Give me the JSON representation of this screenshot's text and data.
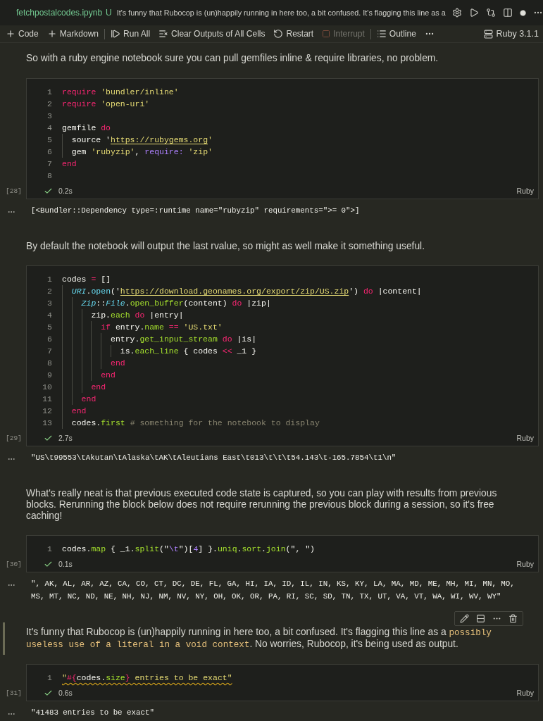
{
  "tab": {
    "file_name": "fetchpostalcodes.ipynb",
    "git_status": "U",
    "breadcrumb": "It's funny that Rubocop is (un)happily running in here too, a bit confused. It's flagging this line as a"
  },
  "toolbar": {
    "groups": [
      {
        "items": [
          {
            "kind": "add",
            "label": "Code",
            "disabled": false
          },
          {
            "kind": "add",
            "label": "Markdown",
            "disabled": false
          }
        ]
      },
      {
        "items": [
          {
            "kind": "run_all",
            "label": "Run All",
            "disabled": false
          },
          {
            "kind": "clear",
            "label": "Clear Outputs of All Cells",
            "disabled": false
          },
          {
            "kind": "restart",
            "label": "Restart",
            "disabled": false
          },
          {
            "kind": "interrupt",
            "label": "Interrupt",
            "disabled": true
          }
        ]
      },
      {
        "items": [
          {
            "kind": "outline",
            "label": "Outline",
            "disabled": false
          },
          {
            "kind": "more",
            "disabled": false
          }
        ]
      }
    ],
    "kernel": "Ruby 3.1.1"
  },
  "cells": [
    {
      "kind": "markdown",
      "selected": false,
      "parts": [
        {
          "kind": "text",
          "text": "So with a ruby engine notebook sure you can pull gemfiles inline & require libraries, no problem."
        }
      ]
    },
    {
      "kind": "code",
      "selected": false,
      "execution_count": "[28]",
      "succeeded": true,
      "duration": "0.2s",
      "language": "Ruby",
      "lint_warning": false,
      "lines": [
        {
          "number": "1",
          "tokens": [
            {
              "kind": "kw",
              "text": "require"
            },
            {
              "kind": "str",
              "text": " 'bundler/inline'"
            }
          ]
        },
        {
          "number": "2",
          "tokens": [
            {
              "kind": "kw",
              "text": "require"
            },
            {
              "kind": "str",
              "text": " 'open-uri'"
            }
          ]
        },
        {
          "number": "3"
        },
        {
          "number": "4",
          "tokens": [
            {
              "kind": "plain",
              "text": "gemfile "
            },
            {
              "kind": "kw",
              "text": "do"
            }
          ]
        },
        {
          "number": "5",
          "tokens": [
            {
              "kind": "plain",
              "text": "  source '"
            },
            {
              "kind": "url",
              "text": "https://rubygems.org"
            },
            {
              "kind": "str",
              "text": "'"
            }
          ]
        },
        {
          "number": "6",
          "tokens": [
            {
              "kind": "plain",
              "text": "  gem "
            },
            {
              "kind": "str",
              "text": "'rubyzip'"
            },
            {
              "kind": "plain",
              "text": ", "
            },
            {
              "kind": "sym",
              "text": "require:"
            },
            {
              "kind": "str",
              "text": " 'zip'"
            }
          ]
        },
        {
          "number": "7",
          "tokens": [
            {
              "kind": "kw",
              "text": "end"
            }
          ]
        },
        {
          "number": "8"
        }
      ],
      "output": "[<Bundler::Dependency type=:runtime name=\"rubyzip\" requirements=\">= 0\">]"
    },
    {
      "kind": "markdown",
      "selected": false,
      "parts": [
        {
          "kind": "text",
          "text": "By default the notebook will output the last rvalue, so might as well make it something useful."
        }
      ]
    },
    {
      "kind": "code",
      "selected": false,
      "execution_count": "[29]",
      "succeeded": true,
      "duration": "2.7s",
      "language": "Ruby",
      "lint_warning": false,
      "lines": [
        {
          "number": "1",
          "tokens": [
            {
              "kind": "plain",
              "text": "codes "
            },
            {
              "kind": "kw",
              "text": "="
            },
            {
              "kind": "plain",
              "text": " []"
            }
          ]
        },
        {
          "number": "2",
          "tokens": [
            {
              "kind": "cls",
              "text": "  URI"
            },
            {
              "kind": "plain",
              "text": "."
            },
            {
              "kind": "method",
              "text": "open"
            },
            {
              "kind": "plain",
              "text": "('"
            },
            {
              "kind": "url",
              "text": "https://download.geonames.org/export/zip/US.zip"
            },
            {
              "kind": "plain",
              "text": "') "
            },
            {
              "kind": "kw",
              "text": "do"
            },
            {
              "kind": "plain",
              "text": " |content|"
            }
          ]
        },
        {
          "number": "3",
          "tokens": [
            {
              "kind": "cls",
              "text": "    Zip"
            },
            {
              "kind": "plain",
              "text": "::"
            },
            {
              "kind": "cls",
              "text": "File"
            },
            {
              "kind": "plain",
              "text": "."
            },
            {
              "kind": "fn",
              "text": "open_buffer"
            },
            {
              "kind": "plain",
              "text": "(content) "
            },
            {
              "kind": "kw",
              "text": "do"
            },
            {
              "kind": "plain",
              "text": " |zip|"
            }
          ]
        },
        {
          "number": "4",
          "tokens": [
            {
              "kind": "plain",
              "text": "      zip."
            },
            {
              "kind": "fn",
              "text": "each"
            },
            {
              "kind": "kw",
              "text": " do"
            },
            {
              "kind": "plain",
              "text": " |entry|"
            }
          ]
        },
        {
          "number": "5",
          "tokens": [
            {
              "kind": "kw",
              "text": "        if"
            },
            {
              "kind": "plain",
              "text": " entry."
            },
            {
              "kind": "fn",
              "text": "name"
            },
            {
              "kind": "kw",
              "text": " =="
            },
            {
              "kind": "str",
              "text": " 'US.txt'"
            }
          ]
        },
        {
          "number": "6",
          "tokens": [
            {
              "kind": "plain",
              "text": "          entry."
            },
            {
              "kind": "fn",
              "text": "get_input_stream"
            },
            {
              "kind": "kw",
              "text": " do"
            },
            {
              "kind": "plain",
              "text": " |is|"
            }
          ]
        },
        {
          "number": "7",
          "tokens": [
            {
              "kind": "plain",
              "text": "            is."
            },
            {
              "kind": "fn",
              "text": "each_line"
            },
            {
              "kind": "plain",
              "text": " { codes "
            },
            {
              "kind": "kw",
              "text": "<<"
            },
            {
              "kind": "plain",
              "text": " _1 }"
            }
          ]
        },
        {
          "number": "8",
          "tokens": [
            {
              "kind": "kw",
              "text": "          end"
            }
          ]
        },
        {
          "number": "9",
          "tokens": [
            {
              "kind": "kw",
              "text": "        end"
            }
          ]
        },
        {
          "number": "10",
          "tokens": [
            {
              "kind": "kw",
              "text": "      end"
            }
          ]
        },
        {
          "number": "11",
          "tokens": [
            {
              "kind": "kw",
              "text": "    end"
            }
          ]
        },
        {
          "number": "12",
          "tokens": [
            {
              "kind": "kw",
              "text": "  end"
            }
          ]
        },
        {
          "number": "13",
          "tokens": [
            {
              "kind": "plain",
              "text": "  codes."
            },
            {
              "kind": "fn",
              "text": "first"
            },
            {
              "kind": "cmt",
              "text": " # something for the notebook to display"
            }
          ]
        }
      ],
      "output": "\"US\\t99553\\tAkutan\\tAlaska\\tAK\\tAleutians East\\t013\\t\\t\\t54.143\\t-165.7854\\t1\\n\""
    },
    {
      "kind": "markdown",
      "selected": false,
      "parts": [
        {
          "kind": "text",
          "text": "What's really neat is that previous executed code state is captured, so you can play with results from previous blocks. Rerunning the block below does not require rerunning the previous block during a session, so it's free caching!"
        }
      ]
    },
    {
      "kind": "code",
      "selected": false,
      "execution_count": "[30]",
      "succeeded": true,
      "duration": "0.1s",
      "language": "Ruby",
      "lint_warning": false,
      "lines": [
        {
          "number": "1",
          "tokens": [
            {
              "kind": "plain",
              "text": "codes."
            },
            {
              "kind": "fn",
              "text": "map"
            },
            {
              "kind": "plain",
              "text": " { _1."
            },
            {
              "kind": "fn",
              "text": "split"
            },
            {
              "kind": "plain",
              "text": "(\""
            },
            {
              "kind": "sym",
              "text": "\\t"
            },
            {
              "kind": "plain",
              "text": "\")["
            },
            {
              "kind": "sym",
              "text": "4"
            },
            {
              "kind": "plain",
              "text": "] }."
            },
            {
              "kind": "fn",
              "text": "uniq"
            },
            {
              "kind": "plain",
              "text": "."
            },
            {
              "kind": "fn",
              "text": "sort"
            },
            {
              "kind": "plain",
              "text": "."
            },
            {
              "kind": "fn",
              "text": "join"
            },
            {
              "kind": "plain",
              "text": "(\", \")"
            }
          ]
        }
      ],
      "output": "\", AK, AL, AR, AZ, CA, CO, CT, DC, DE, FL, GA, HI, IA, ID, IL, IN, KS, KY, LA, MA, MD, ME, MH, MI, MN, MO, MS, MT, NC, ND, NE, NH, NJ, NM, NV, NY, OH, OK, OR, PA, RI, SC, SD, TN, TX, UT, VA, VT, WA, WI, WV, WY\""
    },
    {
      "kind": "markdown",
      "selected": true,
      "parts": [
        {
          "kind": "text",
          "text": "It's funny that Rubocop is (un)happily running in here too, a bit confused. It's flagging this line as a "
        },
        {
          "kind": "code",
          "text": "possibly useless use of a literal in a void context"
        },
        {
          "kind": "text",
          "text": ". No worries, Rubocop, it's being used as output."
        }
      ]
    },
    {
      "kind": "code",
      "selected": false,
      "execution_count": "[31]",
      "succeeded": true,
      "duration": "0.6s",
      "language": "Ruby",
      "lint_warning": true,
      "lines": [
        {
          "number": "1",
          "tokens": [
            {
              "kind": "str",
              "text": "\""
            },
            {
              "kind": "kw",
              "text": "#{"
            },
            {
              "kind": "plain",
              "text": "codes."
            },
            {
              "kind": "fn",
              "text": "size"
            },
            {
              "kind": "kw",
              "text": "}"
            },
            {
              "kind": "str",
              "text": " entries to be exact\""
            }
          ]
        }
      ],
      "output": "\"41483 entries to be exact\""
    }
  ]
}
